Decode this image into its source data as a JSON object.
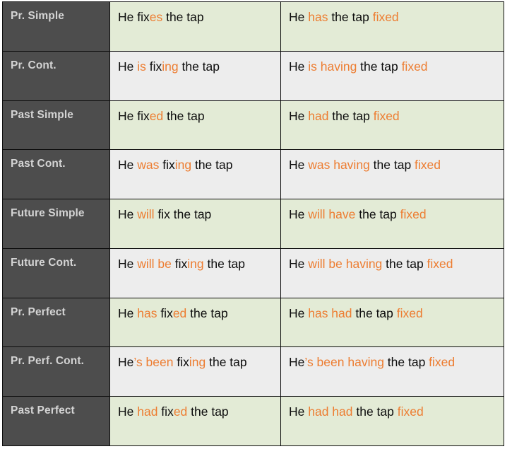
{
  "colors": {
    "label_background": "#4d4d4d",
    "label_text": "#d4d4d4",
    "row_green": "#e3ebd6",
    "row_gray": "#ededed",
    "highlight": "#ed7d31",
    "body_text": "#0d0d0d",
    "border": "#0c0c0c"
  },
  "table": {
    "column_roles": [
      "tense-label",
      "active-sentence",
      "causative-sentence"
    ],
    "rows": [
      {
        "label": "Pr. Simple",
        "shade": "green",
        "active": [
          {
            "t": "He fix",
            "hl": false
          },
          {
            "t": "es",
            "hl": true
          },
          {
            "t": " the tap",
            "hl": false
          }
        ],
        "active_plain": "He fixes the tap",
        "causative": [
          {
            "t": "He ",
            "hl": false
          },
          {
            "t": "has",
            "hl": true
          },
          {
            "t": " the tap ",
            "hl": false
          },
          {
            "t": "fixed",
            "hl": true
          }
        ],
        "causative_plain": "He has the tap fixed"
      },
      {
        "label": "Pr. Cont.",
        "shade": "gray",
        "active": [
          {
            "t": "He ",
            "hl": false
          },
          {
            "t": "is",
            "hl": true
          },
          {
            "t": " fix",
            "hl": false
          },
          {
            "t": "ing",
            "hl": true
          },
          {
            "t": " the tap",
            "hl": false
          }
        ],
        "active_plain": "He is fixing the tap",
        "causative": [
          {
            "t": "He ",
            "hl": false
          },
          {
            "t": "is having",
            "hl": true
          },
          {
            "t": " the tap ",
            "hl": false
          },
          {
            "t": "fixed",
            "hl": true
          }
        ],
        "causative_plain": "He is having the tap fixed"
      },
      {
        "label": "Past Simple",
        "shade": "green",
        "active": [
          {
            "t": "He fix",
            "hl": false
          },
          {
            "t": "ed",
            "hl": true
          },
          {
            "t": " the tap",
            "hl": false
          }
        ],
        "active_plain": "He fixed the tap",
        "causative": [
          {
            "t": "He ",
            "hl": false
          },
          {
            "t": "had",
            "hl": true
          },
          {
            "t": " the tap ",
            "hl": false
          },
          {
            "t": "fixed",
            "hl": true
          }
        ],
        "causative_plain": "He had the tap fixed"
      },
      {
        "label": "Past Cont.",
        "shade": "gray",
        "active": [
          {
            "t": "He ",
            "hl": false
          },
          {
            "t": "was",
            "hl": true
          },
          {
            "t": " fix",
            "hl": false
          },
          {
            "t": "ing",
            "hl": true
          },
          {
            "t": " the tap",
            "hl": false
          }
        ],
        "active_plain": "He was fixing the tap",
        "causative": [
          {
            "t": "He ",
            "hl": false
          },
          {
            "t": "was having",
            "hl": true
          },
          {
            "t": " the tap ",
            "hl": false
          },
          {
            "t": "fixed",
            "hl": true
          }
        ],
        "causative_plain": "He was having the tap fixed"
      },
      {
        "label": "Future Simple",
        "shade": "green",
        "active": [
          {
            "t": "He ",
            "hl": false
          },
          {
            "t": "will",
            "hl": true
          },
          {
            "t": " fix the tap",
            "hl": false
          }
        ],
        "active_plain": "He will fix the tap",
        "causative": [
          {
            "t": "He ",
            "hl": false
          },
          {
            "t": "will have",
            "hl": true
          },
          {
            "t": " the tap ",
            "hl": false
          },
          {
            "t": "fixed",
            "hl": true
          }
        ],
        "causative_plain": "He will have the tap fixed"
      },
      {
        "label": "Future Cont.",
        "shade": "gray",
        "active": [
          {
            "t": "He ",
            "hl": false
          },
          {
            "t": "will be",
            "hl": true
          },
          {
            "t": " fix",
            "hl": false
          },
          {
            "t": "ing",
            "hl": true
          },
          {
            "t": " the tap",
            "hl": false
          }
        ],
        "active_plain": "He will be fixing the tap",
        "causative": [
          {
            "t": "He ",
            "hl": false
          },
          {
            "t": "will be having",
            "hl": true
          },
          {
            "t": " the tap ",
            "hl": false
          },
          {
            "t": "fixed",
            "hl": true
          }
        ],
        "causative_plain": "He will be having the tap fixed"
      },
      {
        "label": "Pr. Perfect",
        "shade": "green",
        "active": [
          {
            "t": "He ",
            "hl": false
          },
          {
            "t": "has",
            "hl": true
          },
          {
            "t": " fix",
            "hl": false
          },
          {
            "t": "ed",
            "hl": true
          },
          {
            "t": " the tap",
            "hl": false
          }
        ],
        "active_plain": "He has fixed the tap",
        "causative": [
          {
            "t": "He ",
            "hl": false
          },
          {
            "t": "has had",
            "hl": true
          },
          {
            "t": " the tap ",
            "hl": false
          },
          {
            "t": "fixed",
            "hl": true
          }
        ],
        "causative_plain": "He has had the tap fixed"
      },
      {
        "label": "Pr. Perf. Cont.",
        "shade": "gray",
        "active": [
          {
            "t": "He",
            "hl": false
          },
          {
            "t": "’s been",
            "hl": true
          },
          {
            "t": " fix",
            "hl": false
          },
          {
            "t": "ing",
            "hl": true
          },
          {
            "t": " the tap",
            "hl": false
          }
        ],
        "active_plain": "He’s been fixing the tap",
        "causative": [
          {
            "t": "He",
            "hl": false
          },
          {
            "t": "’s been having",
            "hl": true
          },
          {
            "t": " the tap ",
            "hl": false
          },
          {
            "t": "fixed",
            "hl": true
          }
        ],
        "causative_plain": "He’s been having the tap fixed"
      },
      {
        "label": "Past Perfect",
        "shade": "green",
        "active": [
          {
            "t": "He ",
            "hl": false
          },
          {
            "t": "had",
            "hl": true
          },
          {
            "t": " fix",
            "hl": false
          },
          {
            "t": "ed",
            "hl": true
          },
          {
            "t": " the tap",
            "hl": false
          }
        ],
        "active_plain": "He had fixed the tap",
        "causative": [
          {
            "t": "He ",
            "hl": false
          },
          {
            "t": "had had",
            "hl": true
          },
          {
            "t": " the tap ",
            "hl": false
          },
          {
            "t": "fixed",
            "hl": true
          }
        ],
        "causative_plain": "He had had the tap fixed"
      }
    ]
  }
}
